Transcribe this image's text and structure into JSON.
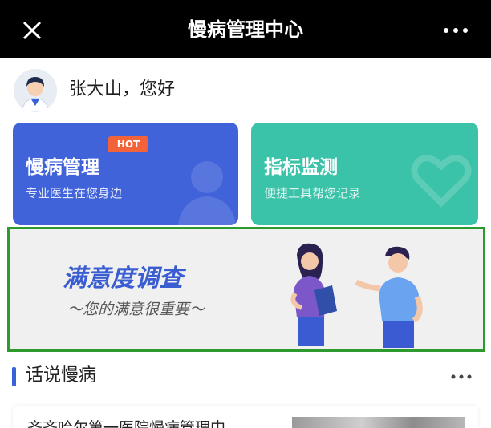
{
  "window": {
    "title": "慢病管理中心",
    "close_icon": "close-icon",
    "more_icon": "more-dots-icon"
  },
  "greeting": {
    "avatar_icon": "doctor-avatar",
    "text": "张大山，您好"
  },
  "cards": [
    {
      "title": "慢病管理",
      "subtitle": "专业医生在您身边",
      "badge": "HOT",
      "color": "#4163d9",
      "icon": "doctor-silhouette-icon"
    },
    {
      "title": "指标监测",
      "subtitle": "便捷工具帮您记录",
      "color": "#3bc3a9",
      "icon": "heart-icon"
    }
  ],
  "banner": {
    "title": "满意度调查",
    "subtitle": "～您的满意很重要～",
    "illustration": "two-people-talking-illustration"
  },
  "section": {
    "title": "话说慢病",
    "more_icon": "more-dots-icon"
  },
  "article": {
    "title": "齐齐哈尔第一医院慢病管理中",
    "thumbnail": "article-thumbnail-image"
  },
  "colors": {
    "topbar": "#000000",
    "accent_blue": "#3a62d8",
    "teal": "#3bc3a9",
    "hot_badge": "#f2633a",
    "banner_border": "#2c9a2c"
  }
}
